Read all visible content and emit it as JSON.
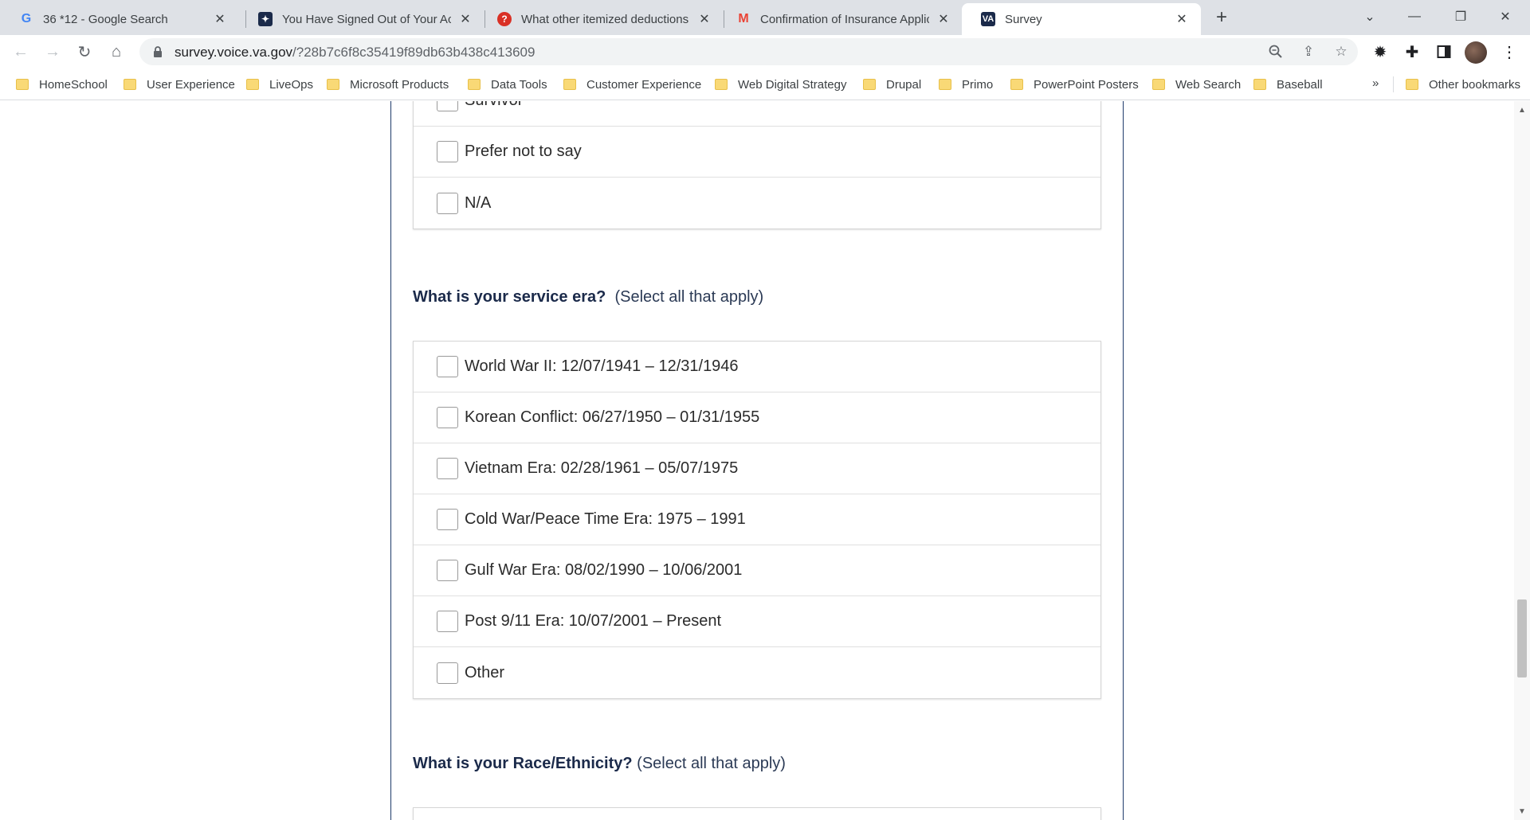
{
  "tabs": [
    {
      "title": "36 *12 - Google Search",
      "icon": "google-icon"
    },
    {
      "title": "You Have Signed Out of Your Acc",
      "icon": "va-seal-icon"
    },
    {
      "title": "What other itemized deductions",
      "icon": "question-icon"
    },
    {
      "title": "Confirmation of Insurance Applic",
      "icon": "gmail-icon"
    },
    {
      "title": "Survey",
      "icon": "va-logo-icon",
      "active": true
    }
  ],
  "tab_icons": {
    "va_text": "VA",
    "gmail_text": "M",
    "google_text": "G"
  },
  "address": {
    "host": "survey.voice.va.gov",
    "path": "/?28b7c6f8c35419f89db63b438c413609"
  },
  "bookmarks": [
    "HomeSchool",
    "User Experience",
    "LiveOps",
    "Microsoft Products",
    "Data Tools",
    "Customer Experience",
    "Web Digital Strategy",
    "Drupal",
    "Primo",
    "PowerPoint Posters",
    "Web Search",
    "Baseball"
  ],
  "bookmarks_more": "»",
  "other_bookmarks": "Other bookmarks",
  "survey": {
    "prev_options": [
      "Survivor",
      "Prefer not to say",
      "N/A"
    ],
    "q_service_era": {
      "label": "What is your service era?",
      "hint": "(Select all that apply)"
    },
    "service_era_options": [
      "World War II: 12/07/1941 – 12/31/1946",
      "Korean Conflict: 06/27/1950 – 01/31/1955",
      "Vietnam Era: 02/28/1961 – 05/07/1975",
      "Cold War/Peace Time Era: 1975 – 1991",
      "Gulf War Era: 08/02/1990 – 10/06/2001",
      "Post 9/11 Era: 10/07/2001 – Present",
      "Other"
    ],
    "q_race": {
      "label": "What is your Race/Ethnicity?",
      "hint": "(Select all that apply)"
    }
  },
  "colors": {
    "panel_border": "#1e3a6a",
    "question_text": "#1b2a4a",
    "tabstrip_bg": "#dee1e6"
  }
}
